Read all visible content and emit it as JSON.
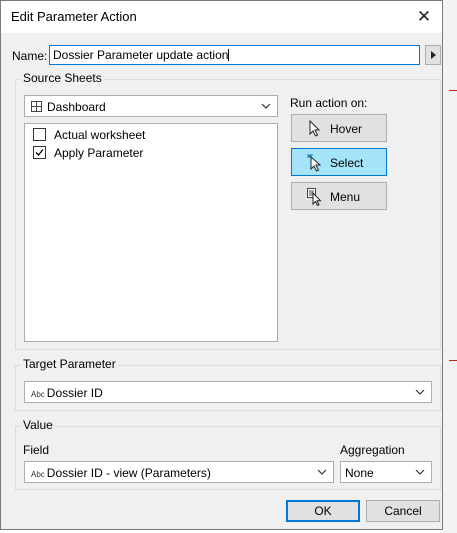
{
  "window": {
    "title": "Edit Parameter Action"
  },
  "name_field": {
    "label": "Name:",
    "value": "Dossier Parameter update action"
  },
  "source_sheets": {
    "title": "Source Sheets",
    "dropdown_value": "Dashboard",
    "items": [
      {
        "label": "Actual worksheet",
        "checked": false
      },
      {
        "label": "Apply Parameter",
        "checked": true
      }
    ]
  },
  "run_action": {
    "label": "Run action on:",
    "buttons": [
      {
        "label": "Hover",
        "icon": "cursor-icon",
        "selected": false
      },
      {
        "label": "Select",
        "icon": "select-cursor-icon",
        "selected": true
      },
      {
        "label": "Menu",
        "icon": "menu-cursor-icon",
        "selected": false
      }
    ]
  },
  "target_parameter": {
    "title": "Target Parameter",
    "type_badge": "Abc",
    "value": "Dossier ID"
  },
  "value_group": {
    "title": "Value",
    "field_label": "Field",
    "field_type_badge": "Abc",
    "field_value": "Dossier ID - view (Parameters)",
    "aggregation_label": "Aggregation",
    "aggregation_value": "None"
  },
  "footer": {
    "ok_label": "OK",
    "cancel_label": "Cancel"
  }
}
